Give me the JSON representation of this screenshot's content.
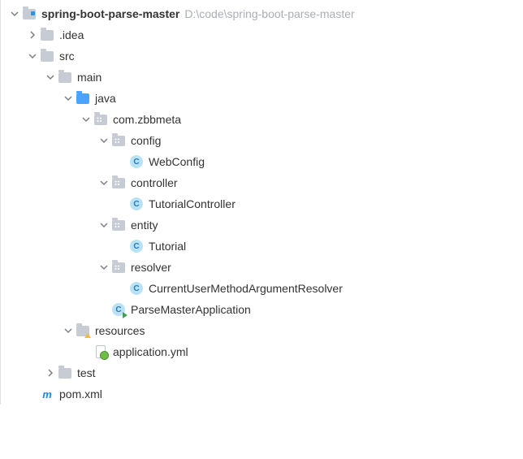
{
  "root": {
    "name": "spring-boot-parse-master",
    "path": "D:\\code\\spring-boot-parse-master"
  },
  "nodes": {
    "idea": ".idea",
    "src": "src",
    "main": "main",
    "java": "java",
    "pkg_root": "com.zbbmeta",
    "config": "config",
    "webconfig": "WebConfig",
    "controller": "controller",
    "tutorialcontroller": "TutorialController",
    "entity": "entity",
    "tutorial": "Tutorial",
    "resolver": "resolver",
    "curusermar": "CurrentUserMethodArgumentResolver",
    "app": "ParseMasterApplication",
    "resources": "resources",
    "appyml": "application.yml",
    "test": "test",
    "pom": "pom.xml"
  },
  "icons": {
    "class_letter": "C",
    "maven_letter": "m"
  }
}
